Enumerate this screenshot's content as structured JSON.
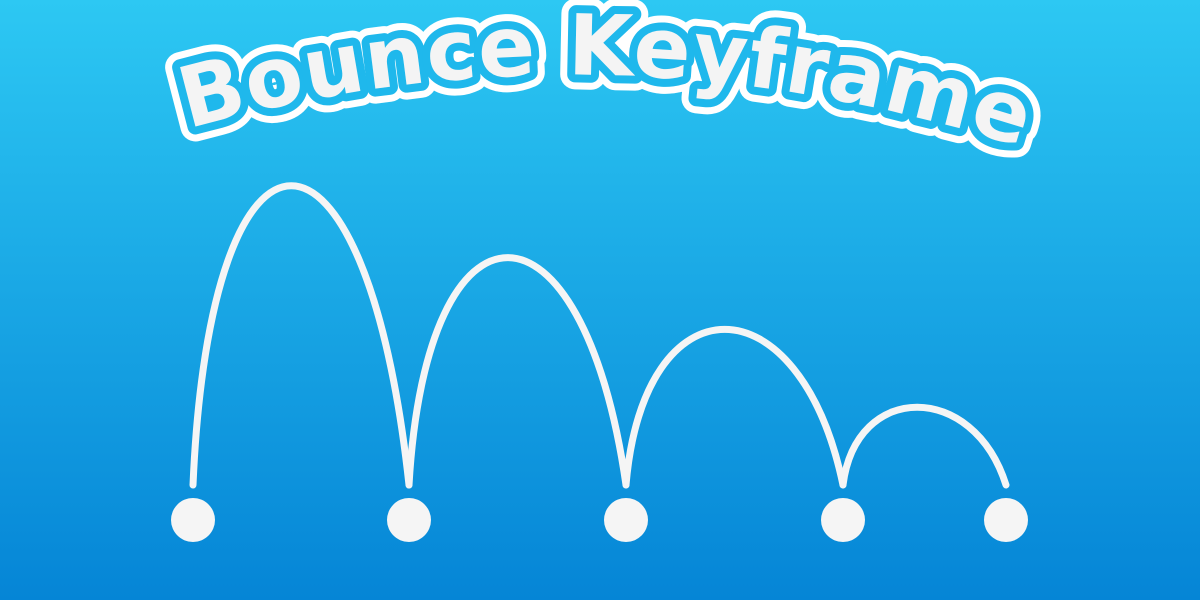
{
  "title": "Bounce Keyframe",
  "colors": {
    "background_top": "#2dc8f3",
    "background_bottom": "#0585d6",
    "path": "#f5f5f5",
    "ball": "#f5f5f5",
    "title_fill": "#f4f4f4",
    "title_outline": "#1fb8ec",
    "title_halo": "#ffffff"
  },
  "diagram": {
    "keyframe_count": 5,
    "bounce_heights_relative": [
      1.0,
      0.76,
      0.52,
      0.26
    ]
  }
}
